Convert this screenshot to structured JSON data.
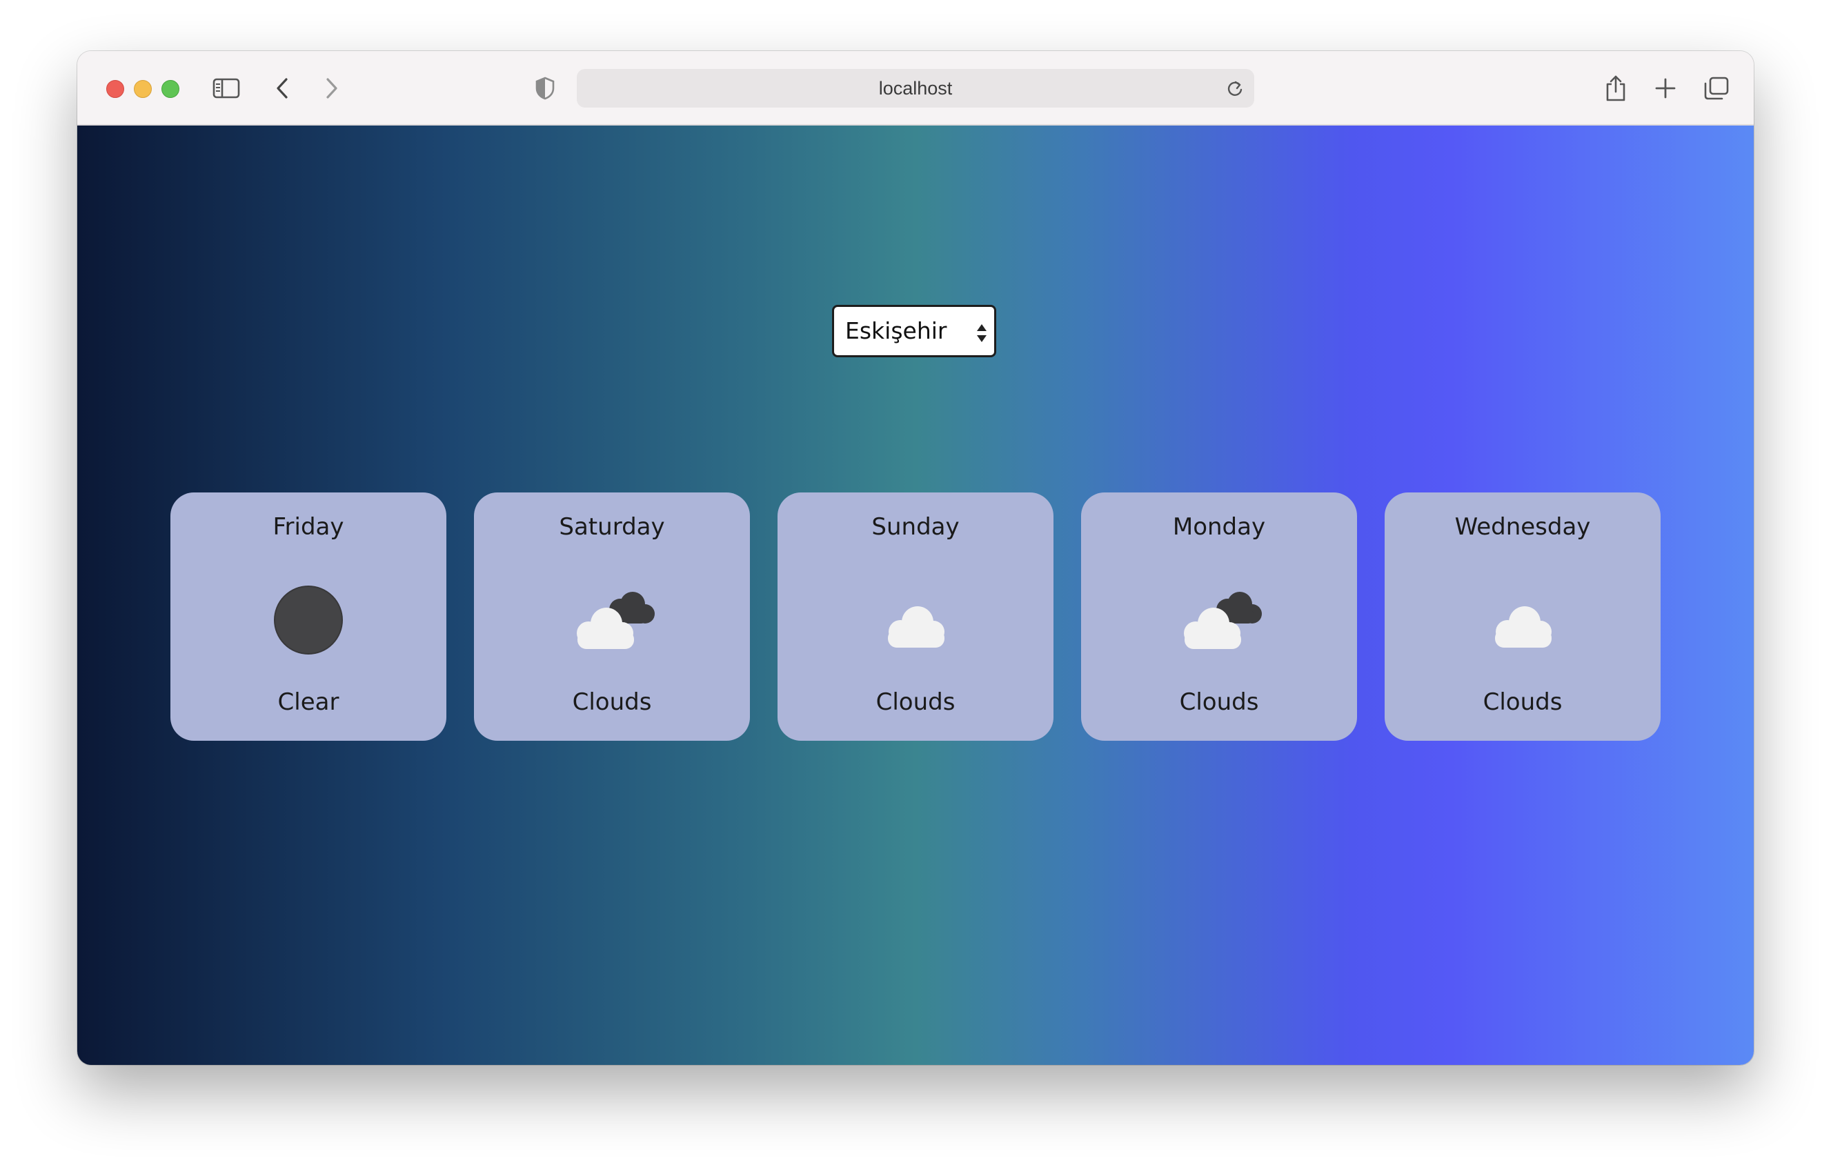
{
  "browser": {
    "url": "localhost",
    "icons": [
      "sidebar-icon",
      "back-arrow-icon",
      "forward-arrow-icon",
      "privacy-shield-icon",
      "reload-icon",
      "share-icon",
      "new-tab-plus-icon",
      "tab-overview-icon"
    ]
  },
  "city_select": {
    "selected": "Eskişehir"
  },
  "forecast": [
    {
      "day": "Friday",
      "condition": "Clear",
      "icon": "clear-moon-icon"
    },
    {
      "day": "Saturday",
      "condition": "Clouds",
      "icon": "broken-clouds-icon"
    },
    {
      "day": "Sunday",
      "condition": "Clouds",
      "icon": "cloud-icon"
    },
    {
      "day": "Monday",
      "condition": "Clouds",
      "icon": "broken-clouds-icon"
    },
    {
      "day": "Wednesday",
      "condition": "Clouds",
      "icon": "cloud-icon"
    }
  ],
  "colors": {
    "card_background": "#adb5d9",
    "gradient_start": "#0b1836",
    "gradient_mid": "#3b8590",
    "gradient_end": "#5b8af5",
    "moon": "#444446",
    "cloud_light": "#f2f2f2",
    "cloud_dark": "#3c3c3e"
  }
}
